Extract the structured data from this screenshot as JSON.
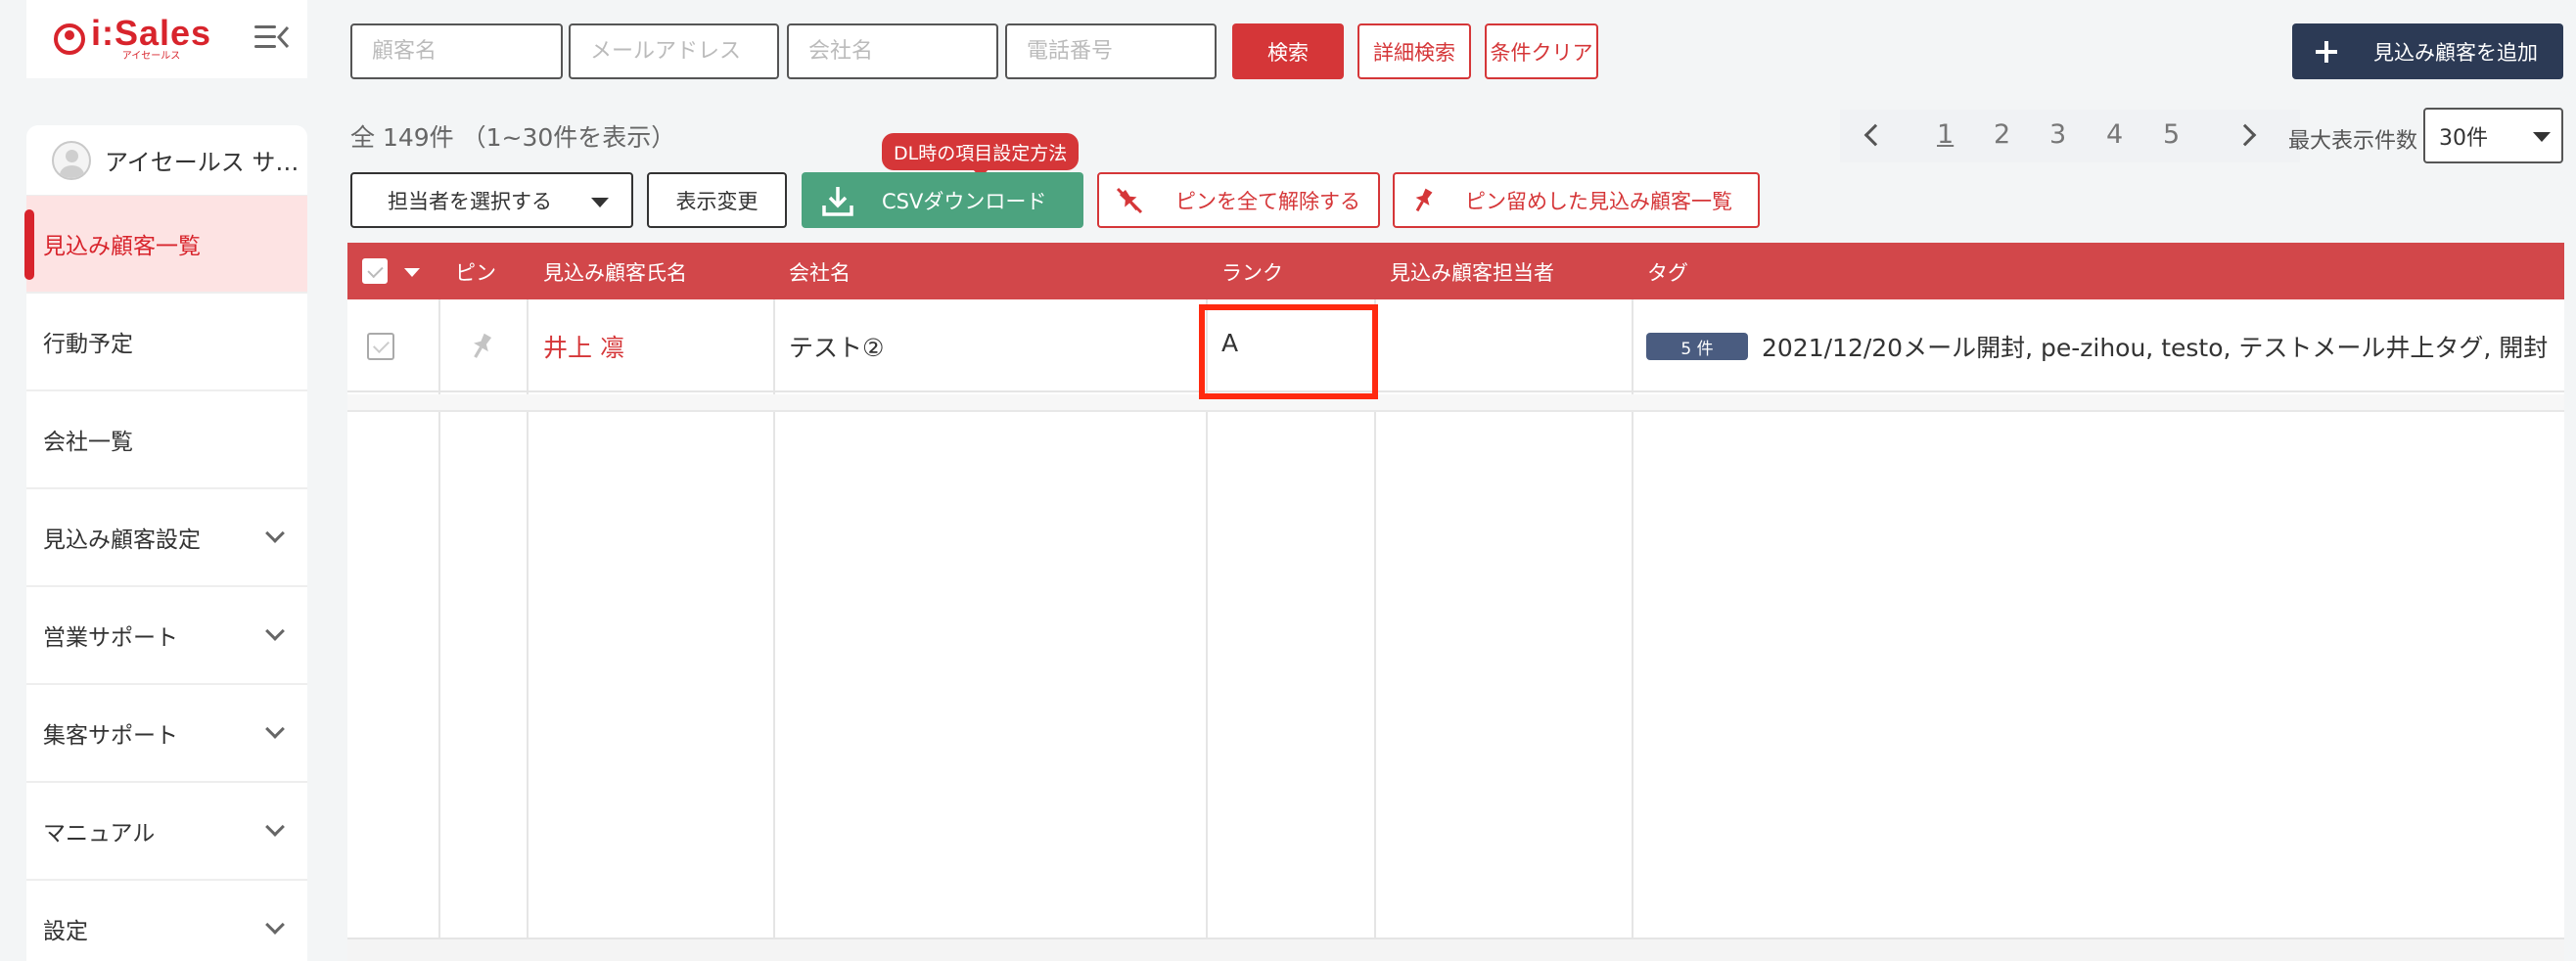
{
  "brand": {
    "name": "i:Sales",
    "sub": "アイセールス"
  },
  "sidebar": {
    "user_name": "アイセールス サ…",
    "items": [
      {
        "label": "見込み顧客一覧",
        "active": true,
        "expandable": false
      },
      {
        "label": "行動予定",
        "active": false,
        "expandable": false
      },
      {
        "label": "会社一覧",
        "active": false,
        "expandable": false
      },
      {
        "label": "見込み顧客設定",
        "active": false,
        "expandable": true
      },
      {
        "label": "営業サポート",
        "active": false,
        "expandable": true
      },
      {
        "label": "集客サポート",
        "active": false,
        "expandable": true
      },
      {
        "label": "マニュアル",
        "active": false,
        "expandable": true
      },
      {
        "label": "設定",
        "active": false,
        "expandable": true
      }
    ]
  },
  "search": {
    "customer_placeholder": "顧客名",
    "email_placeholder": "メールアドレス",
    "company_placeholder": "会社名",
    "phone_placeholder": "電話番号",
    "search_label": "検索",
    "advanced_label": "詳細検索",
    "clear_label": "条件クリア"
  },
  "add_button_label": "見込み顧客を追加",
  "results": {
    "count_text": "全 149件 （1~30件を表示）"
  },
  "pagination": {
    "pages": [
      "1",
      "2",
      "3",
      "4",
      "5"
    ],
    "current": "1",
    "max_label": "最大表示件数",
    "max_value": "30件"
  },
  "toolbar": {
    "assignee_label": "担当者を選択する",
    "view_change_label": "表示変更",
    "csv_label": "CSVダウンロード",
    "csv_tooltip": "DL時の項目設定方法",
    "unpin_all_label": "ピンを全て解除する",
    "pinned_list_label": "ピン留めした見込み顧客一覧"
  },
  "table": {
    "headers": {
      "pin": "ピン",
      "name": "見込み顧客氏名",
      "company": "会社名",
      "rank": "ランク",
      "owner": "見込み顧客担当者",
      "tags": "タグ"
    },
    "rows": [
      {
        "name": "井上 凛",
        "company": "テスト②",
        "rank": "A",
        "owner": "",
        "tag_count": "5 件",
        "tags": "2021/12/20メール開封, pe-zihou, testo, テストメール井上タグ, 開封"
      }
    ]
  },
  "colors": {
    "brand_red": "#d8242c",
    "header_red": "#d2474a",
    "navy": "#2c3a55",
    "green": "#4ca37f",
    "highlight": "#ff2a10"
  }
}
